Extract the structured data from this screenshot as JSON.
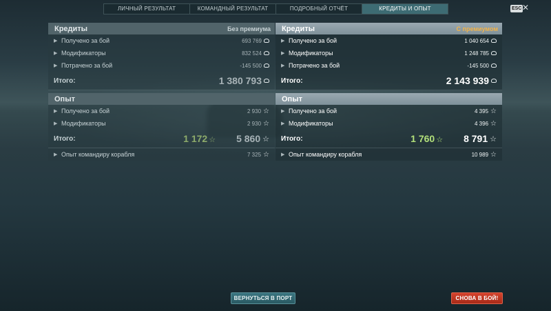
{
  "tabs": [
    {
      "label": "ЛИЧНЫЙ РЕЗУЛЬТАТ"
    },
    {
      "label": "КОМАНДНЫЙ РЕЗУЛЬТАТ"
    },
    {
      "label": "ПОДРОБНЫЙ ОТЧЁТ"
    },
    {
      "label": "КРЕДИТЫ И ОПЫТ"
    }
  ],
  "active_tab": "КРЕДИТЫ И ОПЫТ",
  "esc_label": "ESC",
  "close_glyph": "✕",
  "left": {
    "credits": {
      "title": "Кредиты",
      "subtitle": "Без премиума",
      "rows": [
        {
          "label": "Получено за бой",
          "value": "693 769"
        },
        {
          "label": "Модификаторы",
          "value": "832 524"
        },
        {
          "label": "Потрачено за бой",
          "value": "-145 500"
        }
      ],
      "total_label": "Итого:",
      "total_value": "1 380 793"
    },
    "xp": {
      "title": "Опыт",
      "rows": [
        {
          "label": "Получено за бой",
          "value": "2 930"
        },
        {
          "label": "Модификаторы",
          "value": "2 930"
        }
      ],
      "total_label": "Итого:",
      "free_xp": "1 172",
      "total_value": "5 860"
    },
    "commander": {
      "label": "Опыт командиру корабля",
      "value": "7 325"
    }
  },
  "right": {
    "credits": {
      "title": "Кредиты",
      "subtitle": "С премиумом",
      "rows": [
        {
          "label": "Получено за бой",
          "value": "1 040 654"
        },
        {
          "label": "Модификаторы",
          "value": "1 248 785"
        },
        {
          "label": "Потрачено за бой",
          "value": "-145 500"
        }
      ],
      "total_label": "Итого:",
      "total_value": "2 143 939"
    },
    "xp": {
      "title": "Опыт",
      "rows": [
        {
          "label": "Получено за бой",
          "value": "4 395"
        },
        {
          "label": "Модификаторы",
          "value": "4 396"
        }
      ],
      "total_label": "Итого:",
      "free_xp": "1 760",
      "total_value": "8 791"
    },
    "commander": {
      "label": "Опыт командиру корабля",
      "value": "10 989"
    }
  },
  "buttons": {
    "port": "ВЕРНУТЬСЯ В ПОРТ",
    "battle": "СНОВА В БОЙ!"
  },
  "colors": {
    "active_tab": "#3d6b73",
    "premium_accent": "#f2b349",
    "free_xp_green": "#b2e07a",
    "battle_button": "#c0392b",
    "port_button": "#2f6870"
  },
  "icons": {
    "credit": "credits-coin-icon",
    "xp": "xp-star-icon",
    "expand": "expand-arrow-icon"
  }
}
